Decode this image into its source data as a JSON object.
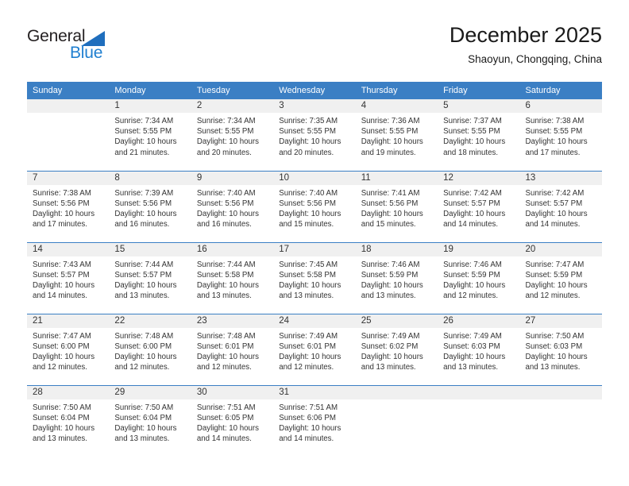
{
  "brand": {
    "name_top": "General",
    "name_bottom": "Blue",
    "triangle_color": "#1f6ebd",
    "blue_color": "#1f7fd0"
  },
  "header": {
    "title": "December 2025",
    "subtitle": "Shaoyun, Chongqing, China"
  },
  "theme": {
    "header_blue": "#3b7fc4",
    "daynum_band": "#f0f0f0",
    "text": "#333333"
  },
  "weekday_headers": [
    "Sunday",
    "Monday",
    "Tuesday",
    "Wednesday",
    "Thursday",
    "Friday",
    "Saturday"
  ],
  "labels": {
    "sunrise": "Sunrise:",
    "sunset": "Sunset:",
    "daylight": "Daylight:"
  },
  "weeks": [
    [
      {
        "day": "",
        "empty": true
      },
      {
        "day": "1",
        "sunrise": "Sunrise: 7:34 AM",
        "sunset": "Sunset: 5:55 PM",
        "daylight": "Daylight: 10 hours and 21 minutes."
      },
      {
        "day": "2",
        "sunrise": "Sunrise: 7:34 AM",
        "sunset": "Sunset: 5:55 PM",
        "daylight": "Daylight: 10 hours and 20 minutes."
      },
      {
        "day": "3",
        "sunrise": "Sunrise: 7:35 AM",
        "sunset": "Sunset: 5:55 PM",
        "daylight": "Daylight: 10 hours and 20 minutes."
      },
      {
        "day": "4",
        "sunrise": "Sunrise: 7:36 AM",
        "sunset": "Sunset: 5:55 PM",
        "daylight": "Daylight: 10 hours and 19 minutes."
      },
      {
        "day": "5",
        "sunrise": "Sunrise: 7:37 AM",
        "sunset": "Sunset: 5:55 PM",
        "daylight": "Daylight: 10 hours and 18 minutes."
      },
      {
        "day": "6",
        "sunrise": "Sunrise: 7:38 AM",
        "sunset": "Sunset: 5:55 PM",
        "daylight": "Daylight: 10 hours and 17 minutes."
      }
    ],
    [
      {
        "day": "7",
        "sunrise": "Sunrise: 7:38 AM",
        "sunset": "Sunset: 5:56 PM",
        "daylight": "Daylight: 10 hours and 17 minutes."
      },
      {
        "day": "8",
        "sunrise": "Sunrise: 7:39 AM",
        "sunset": "Sunset: 5:56 PM",
        "daylight": "Daylight: 10 hours and 16 minutes."
      },
      {
        "day": "9",
        "sunrise": "Sunrise: 7:40 AM",
        "sunset": "Sunset: 5:56 PM",
        "daylight": "Daylight: 10 hours and 16 minutes."
      },
      {
        "day": "10",
        "sunrise": "Sunrise: 7:40 AM",
        "sunset": "Sunset: 5:56 PM",
        "daylight": "Daylight: 10 hours and 15 minutes."
      },
      {
        "day": "11",
        "sunrise": "Sunrise: 7:41 AM",
        "sunset": "Sunset: 5:56 PM",
        "daylight": "Daylight: 10 hours and 15 minutes."
      },
      {
        "day": "12",
        "sunrise": "Sunrise: 7:42 AM",
        "sunset": "Sunset: 5:57 PM",
        "daylight": "Daylight: 10 hours and 14 minutes."
      },
      {
        "day": "13",
        "sunrise": "Sunrise: 7:42 AM",
        "sunset": "Sunset: 5:57 PM",
        "daylight": "Daylight: 10 hours and 14 minutes."
      }
    ],
    [
      {
        "day": "14",
        "sunrise": "Sunrise: 7:43 AM",
        "sunset": "Sunset: 5:57 PM",
        "daylight": "Daylight: 10 hours and 14 minutes."
      },
      {
        "day": "15",
        "sunrise": "Sunrise: 7:44 AM",
        "sunset": "Sunset: 5:57 PM",
        "daylight": "Daylight: 10 hours and 13 minutes."
      },
      {
        "day": "16",
        "sunrise": "Sunrise: 7:44 AM",
        "sunset": "Sunset: 5:58 PM",
        "daylight": "Daylight: 10 hours and 13 minutes."
      },
      {
        "day": "17",
        "sunrise": "Sunrise: 7:45 AM",
        "sunset": "Sunset: 5:58 PM",
        "daylight": "Daylight: 10 hours and 13 minutes."
      },
      {
        "day": "18",
        "sunrise": "Sunrise: 7:46 AM",
        "sunset": "Sunset: 5:59 PM",
        "daylight": "Daylight: 10 hours and 13 minutes."
      },
      {
        "day": "19",
        "sunrise": "Sunrise: 7:46 AM",
        "sunset": "Sunset: 5:59 PM",
        "daylight": "Daylight: 10 hours and 12 minutes."
      },
      {
        "day": "20",
        "sunrise": "Sunrise: 7:47 AM",
        "sunset": "Sunset: 5:59 PM",
        "daylight": "Daylight: 10 hours and 12 minutes."
      }
    ],
    [
      {
        "day": "21",
        "sunrise": "Sunrise: 7:47 AM",
        "sunset": "Sunset: 6:00 PM",
        "daylight": "Daylight: 10 hours and 12 minutes."
      },
      {
        "day": "22",
        "sunrise": "Sunrise: 7:48 AM",
        "sunset": "Sunset: 6:00 PM",
        "daylight": "Daylight: 10 hours and 12 minutes."
      },
      {
        "day": "23",
        "sunrise": "Sunrise: 7:48 AM",
        "sunset": "Sunset: 6:01 PM",
        "daylight": "Daylight: 10 hours and 12 minutes."
      },
      {
        "day": "24",
        "sunrise": "Sunrise: 7:49 AM",
        "sunset": "Sunset: 6:01 PM",
        "daylight": "Daylight: 10 hours and 12 minutes."
      },
      {
        "day": "25",
        "sunrise": "Sunrise: 7:49 AM",
        "sunset": "Sunset: 6:02 PM",
        "daylight": "Daylight: 10 hours and 13 minutes."
      },
      {
        "day": "26",
        "sunrise": "Sunrise: 7:49 AM",
        "sunset": "Sunset: 6:03 PM",
        "daylight": "Daylight: 10 hours and 13 minutes."
      },
      {
        "day": "27",
        "sunrise": "Sunrise: 7:50 AM",
        "sunset": "Sunset: 6:03 PM",
        "daylight": "Daylight: 10 hours and 13 minutes."
      }
    ],
    [
      {
        "day": "28",
        "sunrise": "Sunrise: 7:50 AM",
        "sunset": "Sunset: 6:04 PM",
        "daylight": "Daylight: 10 hours and 13 minutes."
      },
      {
        "day": "29",
        "sunrise": "Sunrise: 7:50 AM",
        "sunset": "Sunset: 6:04 PM",
        "daylight": "Daylight: 10 hours and 13 minutes."
      },
      {
        "day": "30",
        "sunrise": "Sunrise: 7:51 AM",
        "sunset": "Sunset: 6:05 PM",
        "daylight": "Daylight: 10 hours and 14 minutes."
      },
      {
        "day": "31",
        "sunrise": "Sunrise: 7:51 AM",
        "sunset": "Sunset: 6:06 PM",
        "daylight": "Daylight: 10 hours and 14 minutes."
      },
      {
        "day": "",
        "empty": true
      },
      {
        "day": "",
        "empty": true
      },
      {
        "day": "",
        "empty": true
      }
    ]
  ]
}
